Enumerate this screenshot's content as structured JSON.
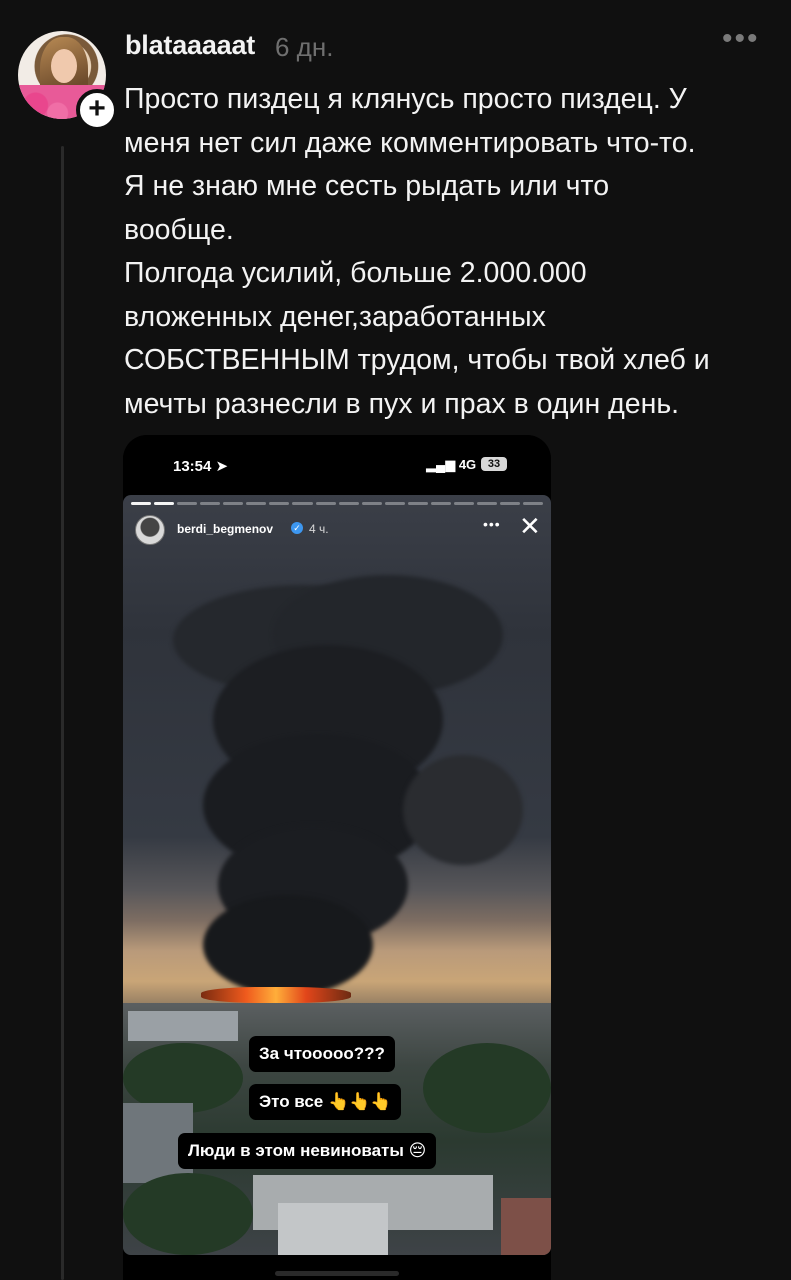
{
  "post": {
    "username": "blataaaaat",
    "time": "6 дн.",
    "more_label": "•••",
    "add_label": "+",
    "text_lines": [
      "Просто пиздец я клянусь просто пиздец. У",
      "меня нет сил даже комментировать что-то.",
      "Я не знаю мне сесть рыдать или что",
      "вообще.",
      "Полгода усилий, больше 2.000.000",
      "вложенных денег,заработанных",
      "СОБСТВЕННЫМ трудом, чтобы твой хлеб и",
      "мечты разнесли в пух и прах в один день."
    ]
  },
  "screenshot": {
    "status_time": "13:54",
    "status_network": "4G",
    "status_battery": "33",
    "story": {
      "username": "berdi_begmenov",
      "verified_mark": "✓",
      "time": "4 ч.",
      "more_label": "•••",
      "close_label": "✕",
      "stickers": [
        "За чтооооо???",
        "Это все 👆👆👆",
        "Люди в этом невиноваты 😔"
      ]
    }
  },
  "colors": {
    "background": "#101010",
    "text": "#f3f3f3",
    "muted": "#6f6f6f"
  }
}
